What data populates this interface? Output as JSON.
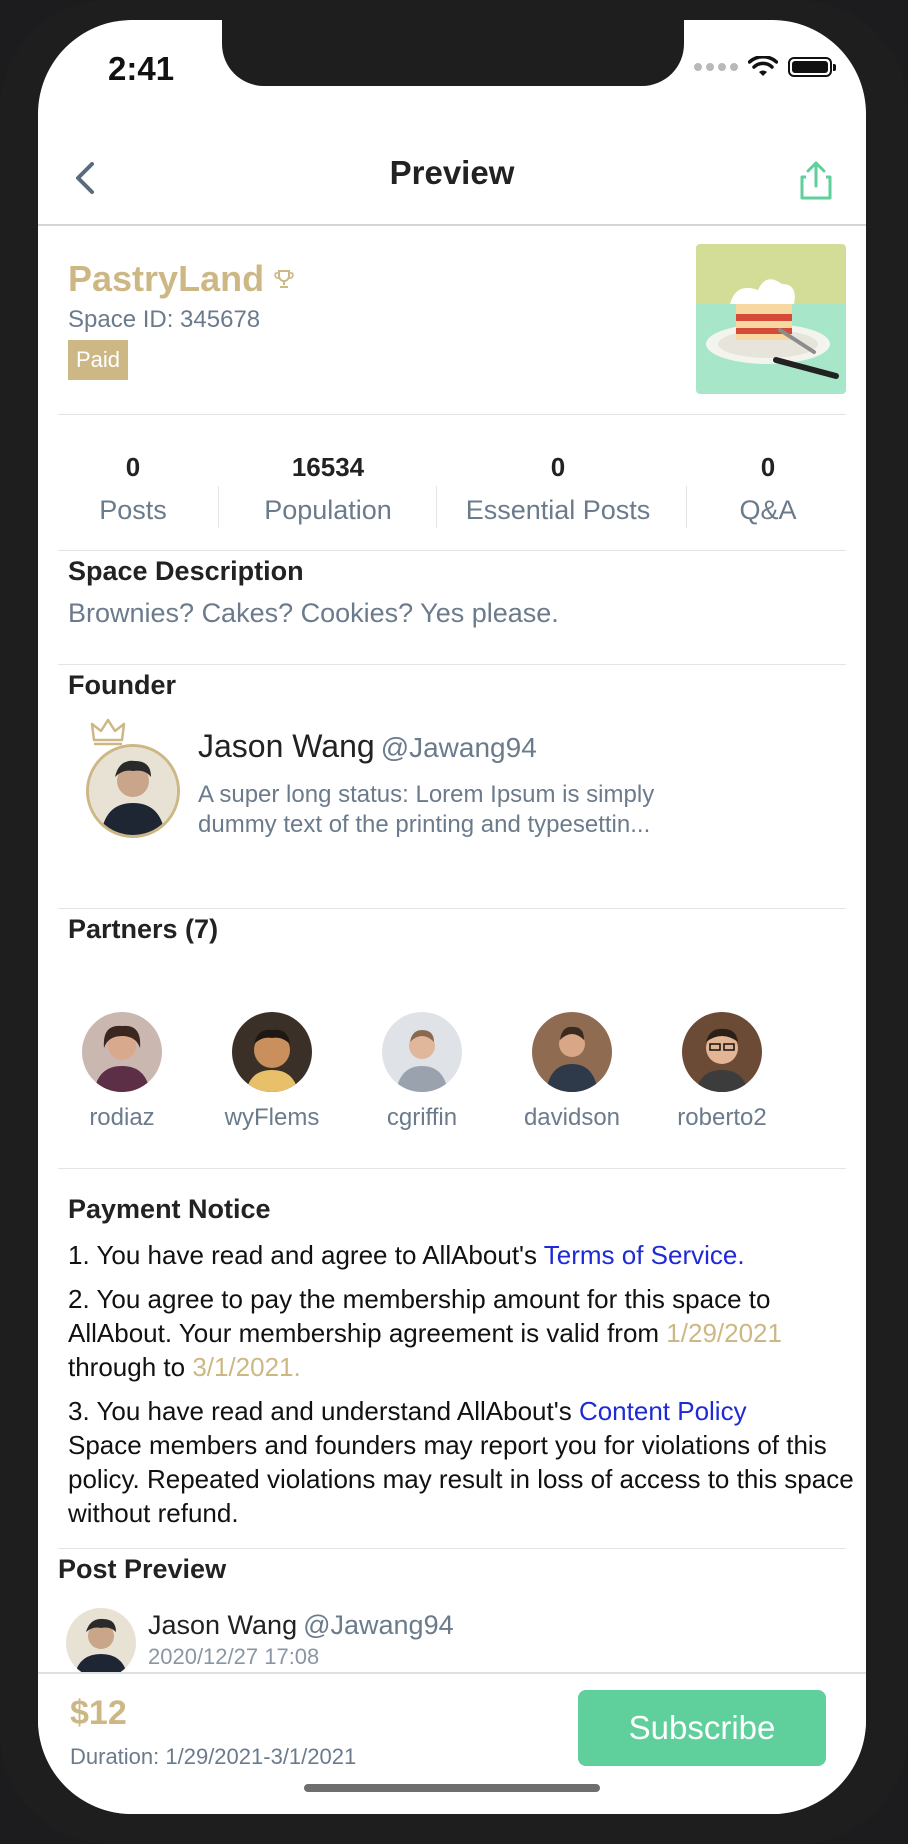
{
  "status_bar": {
    "time": "2:41"
  },
  "navbar": {
    "title": "Preview",
    "back_icon": "chevron-left-icon",
    "share_icon": "share-icon"
  },
  "space": {
    "name": "PastryLand",
    "id_text": "Space ID: 345678",
    "badge": "Paid",
    "trophy_icon": "trophy-icon",
    "accent_color": "#cdb885"
  },
  "stats": [
    {
      "value": "0",
      "label": "Posts"
    },
    {
      "value": "16534",
      "label": "Population"
    },
    {
      "value": "0",
      "label": "Essential Posts"
    },
    {
      "value": "0",
      "label": "Q&A"
    }
  ],
  "description": {
    "title": "Space Description",
    "text": "Brownies? Cakes? Cookies? Yes please."
  },
  "founder": {
    "title": "Founder",
    "name": "Jason Wang",
    "handle": "@Jawang94",
    "status": "A super long status: Lorem Ipsum is simply dummy text of the printing and typesettin..."
  },
  "partners": {
    "title": "Partners (7)",
    "items": [
      {
        "name": "rodiaz"
      },
      {
        "name": "wyFlems"
      },
      {
        "name": "cgriffin"
      },
      {
        "name": "davidson"
      },
      {
        "name": "roberto2"
      }
    ]
  },
  "payment": {
    "title": "Payment Notice",
    "p1_prefix": "1. You have read and agree to AllAbout's ",
    "p1_link": "Terms of Service.",
    "p2_text": "2. You agree to pay the membership amount for this space to AllAbout. Your membership agreement is valid from ",
    "p2_start": "1/29/2021",
    "p2_mid": " through to ",
    "p2_end": "3/1/2021.",
    "p3_prefix": "3. You have read and understand AllAbout's ",
    "p3_link": "Content Policy",
    "p3_rest": "Space members and founders may report you for violations of this policy. Repeated violations may result in loss of access to this space without refund."
  },
  "post_preview": {
    "title": "Post Preview",
    "name": "Jason Wang",
    "handle": "@Jawang94",
    "time": "2020/12/27 17:08"
  },
  "bottom_bar": {
    "price": "$12",
    "duration": "Duration: 1/29/2021-3/1/2021",
    "subscribe_label": "Subscribe",
    "button_color": "#5fcf9c"
  }
}
